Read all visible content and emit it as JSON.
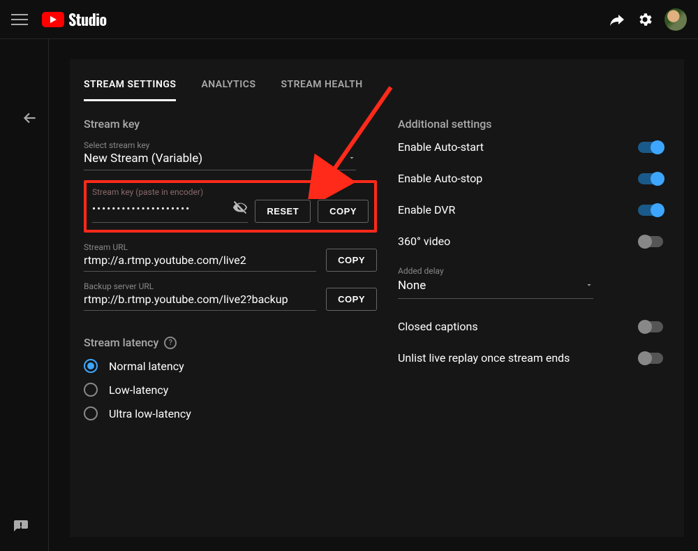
{
  "header": {
    "brand": "Studio"
  },
  "tabs": {
    "settings": "STREAM SETTINGS",
    "analytics": "ANALYTICS",
    "health": "STREAM HEALTH"
  },
  "stream_key": {
    "section_title": "Stream key",
    "select_label": "Select stream key",
    "select_value": "New Stream (Variable)",
    "key_label": "Stream key (paste in encoder)",
    "key_value": "••••••••••••••••••••",
    "reset_btn": "RESET",
    "copy_btn": "COPY",
    "url_label": "Stream URL",
    "url_value": "rtmp://a.rtmp.youtube.com/live2",
    "url_copy": "COPY",
    "backup_label": "Backup server URL",
    "backup_value": "rtmp://b.rtmp.youtube.com/live2?backup",
    "backup_copy": "COPY"
  },
  "latency": {
    "title": "Stream latency",
    "opt_normal": "Normal latency",
    "opt_low": "Low-latency",
    "opt_ultra": "Ultra low-latency"
  },
  "additional": {
    "title": "Additional settings",
    "auto_start": "Enable Auto-start",
    "auto_stop": "Enable Auto-stop",
    "dvr": "Enable DVR",
    "v360": "360° video",
    "delay_label": "Added delay",
    "delay_value": "None",
    "captions": "Closed captions",
    "unlist": "Unlist live replay once stream ends"
  }
}
